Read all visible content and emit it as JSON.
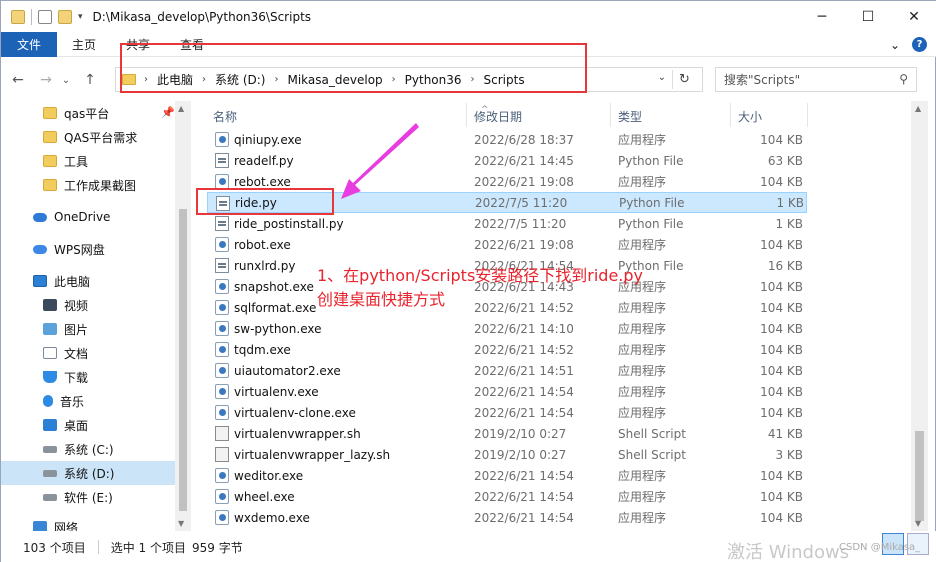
{
  "window": {
    "title": "D:\\Mikasa_develop\\Python36\\Scripts",
    "minimize": "─",
    "maximize": "☐",
    "close": "✕"
  },
  "ribbon": {
    "tabs": [
      "文件",
      "主页",
      "共享",
      "查看"
    ],
    "expand": "⌄",
    "help": "?"
  },
  "nav": {
    "back": "←",
    "forward": "→",
    "recent": "⌄",
    "up": "↑",
    "breadcrumb": [
      "此电脑",
      "系统 (D:)",
      "Mikasa_develop",
      "Python36",
      "Scripts"
    ],
    "breadcrumb_sep": "›",
    "dropdown": "⌄",
    "refresh": "↻",
    "search_placeholder": "搜索\"Scripts\"",
    "search_icon": "⚲"
  },
  "sidebar": [
    {
      "label": "qas平台",
      "icon": "fold",
      "pinned": true
    },
    {
      "label": "QAS平台需求",
      "icon": "fold"
    },
    {
      "label": "工具",
      "icon": "fold"
    },
    {
      "label": "工作成果截图",
      "icon": "fold"
    },
    {
      "label": "OneDrive",
      "icon": "cloud"
    },
    {
      "label": "WPS网盘",
      "icon": "wps"
    },
    {
      "label": "此电脑",
      "icon": "pc"
    },
    {
      "label": "视频",
      "icon": "video"
    },
    {
      "label": "图片",
      "icon": "pic"
    },
    {
      "label": "文档",
      "icon": "docs"
    },
    {
      "label": "下载",
      "icon": "dl"
    },
    {
      "label": "音乐",
      "icon": "music"
    },
    {
      "label": "桌面",
      "icon": "desk"
    },
    {
      "label": "系统 (C:)",
      "icon": "drive"
    },
    {
      "label": "系统 (D:)",
      "icon": "drive",
      "selected": true
    },
    {
      "label": "软件 (E:)",
      "icon": "drive"
    },
    {
      "label": "网络",
      "icon": "net"
    }
  ],
  "pin_glyph": "📌",
  "columns": {
    "name": "名称",
    "date": "修改日期",
    "type": "类型",
    "size": "大小",
    "sort_glyph": "^"
  },
  "files": [
    {
      "name": "qiniupy.exe",
      "date": "2022/6/28 18:37",
      "type": "应用程序",
      "size": "104 KB",
      "kind": "exe"
    },
    {
      "name": "readelf.py",
      "date": "2022/6/21 14:45",
      "type": "Python File",
      "size": "63 KB",
      "kind": "py"
    },
    {
      "name": "rebot.exe",
      "date": "2022/6/21 19:08",
      "type": "应用程序",
      "size": "104 KB",
      "kind": "exe"
    },
    {
      "name": "ride.py",
      "date": "2022/7/5 11:20",
      "type": "Python File",
      "size": "1 KB",
      "kind": "py",
      "selected": true
    },
    {
      "name": "ride_postinstall.py",
      "date": "2022/7/5 11:20",
      "type": "Python File",
      "size": "1 KB",
      "kind": "py"
    },
    {
      "name": "robot.exe",
      "date": "2022/6/21 19:08",
      "type": "应用程序",
      "size": "104 KB",
      "kind": "exe"
    },
    {
      "name": "runxlrd.py",
      "date": "2022/6/21 14:54",
      "type": "Python File",
      "size": "16 KB",
      "kind": "py"
    },
    {
      "name": "snapshot.exe",
      "date": "2022/6/21 14:43",
      "type": "应用程序",
      "size": "104 KB",
      "kind": "exe"
    },
    {
      "name": "sqlformat.exe",
      "date": "2022/6/21 14:52",
      "type": "应用程序",
      "size": "104 KB",
      "kind": "exe"
    },
    {
      "name": "sw-python.exe",
      "date": "2022/6/21 14:10",
      "type": "应用程序",
      "size": "104 KB",
      "kind": "exe"
    },
    {
      "name": "tqdm.exe",
      "date": "2022/6/21 14:52",
      "type": "应用程序",
      "size": "104 KB",
      "kind": "exe"
    },
    {
      "name": "uiautomator2.exe",
      "date": "2022/6/21 14:51",
      "type": "应用程序",
      "size": "104 KB",
      "kind": "exe"
    },
    {
      "name": "virtualenv.exe",
      "date": "2022/6/21 14:54",
      "type": "应用程序",
      "size": "104 KB",
      "kind": "exe"
    },
    {
      "name": "virtualenv-clone.exe",
      "date": "2022/6/21 14:54",
      "type": "应用程序",
      "size": "104 KB",
      "kind": "exe"
    },
    {
      "name": "virtualenvwrapper.sh",
      "date": "2019/2/10 0:27",
      "type": "Shell Script",
      "size": "41 KB",
      "kind": "sh"
    },
    {
      "name": "virtualenvwrapper_lazy.sh",
      "date": "2019/2/10 0:27",
      "type": "Shell Script",
      "size": "3 KB",
      "kind": "sh"
    },
    {
      "name": "weditor.exe",
      "date": "2022/6/21 14:54",
      "type": "应用程序",
      "size": "104 KB",
      "kind": "exe"
    },
    {
      "name": "wheel.exe",
      "date": "2022/6/21 14:54",
      "type": "应用程序",
      "size": "104 KB",
      "kind": "exe"
    },
    {
      "name": "wxdemo.exe",
      "date": "2022/6/21 14:54",
      "type": "应用程序",
      "size": "104 KB",
      "kind": "exe"
    }
  ],
  "annotation": {
    "line1": "1、在python/Scripts安装路径下找到ride.py",
    "line2": "创建桌面快捷方式"
  },
  "status": {
    "count": "103 个项目",
    "selected": "选中 1 个项目",
    "size": "959 字节"
  },
  "watermark": "激活 Windows",
  "csdn": "CSDN @Mikasa_",
  "colors": {
    "accent": "#1c63b7",
    "selection": "#cce8ff",
    "annotation": "#e8363a",
    "arrow": "#e83ce0"
  }
}
